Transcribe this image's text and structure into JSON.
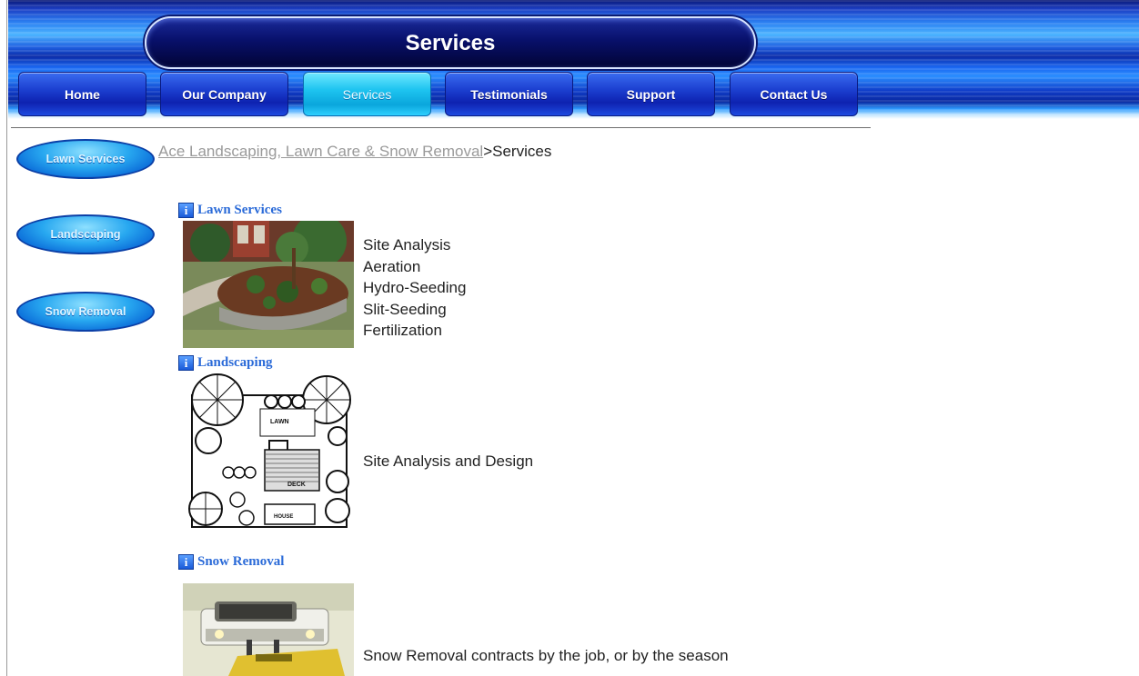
{
  "header": {
    "title": "Services"
  },
  "nav": [
    {
      "label": "Home",
      "active": false
    },
    {
      "label": "Our Company",
      "active": false
    },
    {
      "label": "Services",
      "active": true
    },
    {
      "label": "Testimonials",
      "active": false
    },
    {
      "label": "Support",
      "active": false
    },
    {
      "label": "Contact Us",
      "active": false
    }
  ],
  "sidebar": [
    {
      "label": "Lawn Services"
    },
    {
      "label": "Landscaping"
    },
    {
      "label": "Snow Removal"
    }
  ],
  "breadcrumb": {
    "link": "Ace Landscaping, Lawn Care & Snow Removal",
    "separator": ">",
    "current": "Services"
  },
  "sections": [
    {
      "heading": "Lawn Services",
      "items": [
        "Site Analysis",
        "Aeration",
        "Hydro-Seeding",
        "Slit-Seeding",
        "Fertilization"
      ]
    },
    {
      "heading": "Landscaping",
      "description": "Site Analysis and Design",
      "plan_labels": {
        "lawn": "LAWN",
        "deck": "DECK",
        "house": "HOUSE"
      }
    },
    {
      "heading": "Snow Removal",
      "description": "Snow Removal contracts by the job, or by the season"
    }
  ],
  "icons": {
    "info": "i"
  },
  "colors": {
    "header_dark": "#0a1a78",
    "nav_active": "#1ec4f0",
    "heading_link": "#2a6ad8",
    "breadcrumb_link": "#9a9a9a"
  }
}
